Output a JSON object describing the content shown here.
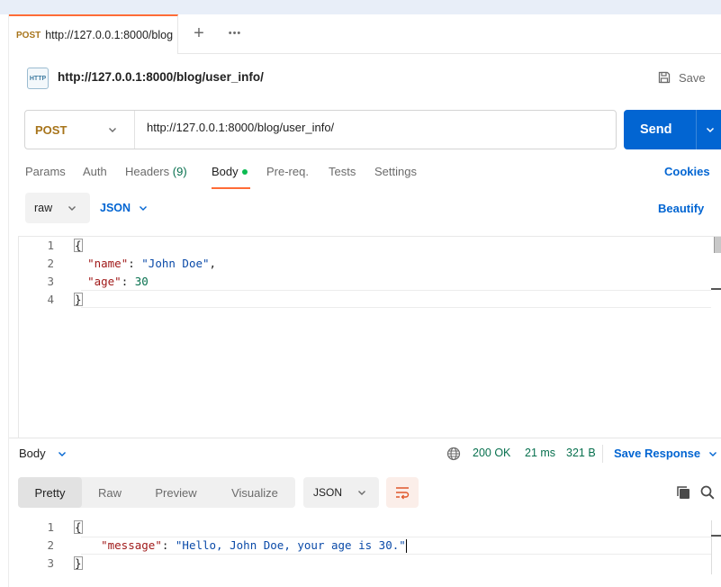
{
  "tab": {
    "method": "POST",
    "title": "http://127.0.0.1:8000/blog"
  },
  "tab_bar": {
    "add_icon": "+",
    "more_icon": "•••"
  },
  "request": {
    "icon_text": "HTTP",
    "title": "http://127.0.0.1:8000/blog/user_info/",
    "save_label": "Save",
    "method": "POST",
    "url": "http://127.0.0.1:8000/blog/user_info/",
    "send_label": "Send"
  },
  "request_tabs": {
    "params": "Params",
    "auth": "Auth",
    "headers": "Headers",
    "headers_count": "(9)",
    "body": "Body",
    "prereq": "Pre-req.",
    "tests": "Tests",
    "settings": "Settings",
    "cookies": "Cookies"
  },
  "body_options": {
    "mode": "raw",
    "language": "JSON",
    "beautify": "Beautify"
  },
  "request_body": {
    "line_numbers": [
      "1",
      "2",
      "3",
      "4"
    ],
    "open_brace": "{",
    "key1": "\"name\"",
    "val1": "\"John Doe\"",
    "key2": "\"age\"",
    "val2": "30",
    "close_brace": "}"
  },
  "response": {
    "section_label": "Body",
    "status": "200 OK",
    "time": "21 ms",
    "size": "321 B",
    "save_response": "Save Response",
    "view_tabs": [
      "Pretty",
      "Raw",
      "Preview",
      "Visualize"
    ],
    "format": "JSON",
    "line_numbers": [
      "1",
      "2",
      "3"
    ],
    "open_brace": "{",
    "key": "\"message\"",
    "value": "\"Hello, John Doe, your age is 30.\"",
    "close_brace": "}"
  },
  "colors": {
    "accent": "#ff6c37",
    "primary": "#0265d2",
    "method_post": "#a7741a",
    "status_ok": "#07704e"
  }
}
